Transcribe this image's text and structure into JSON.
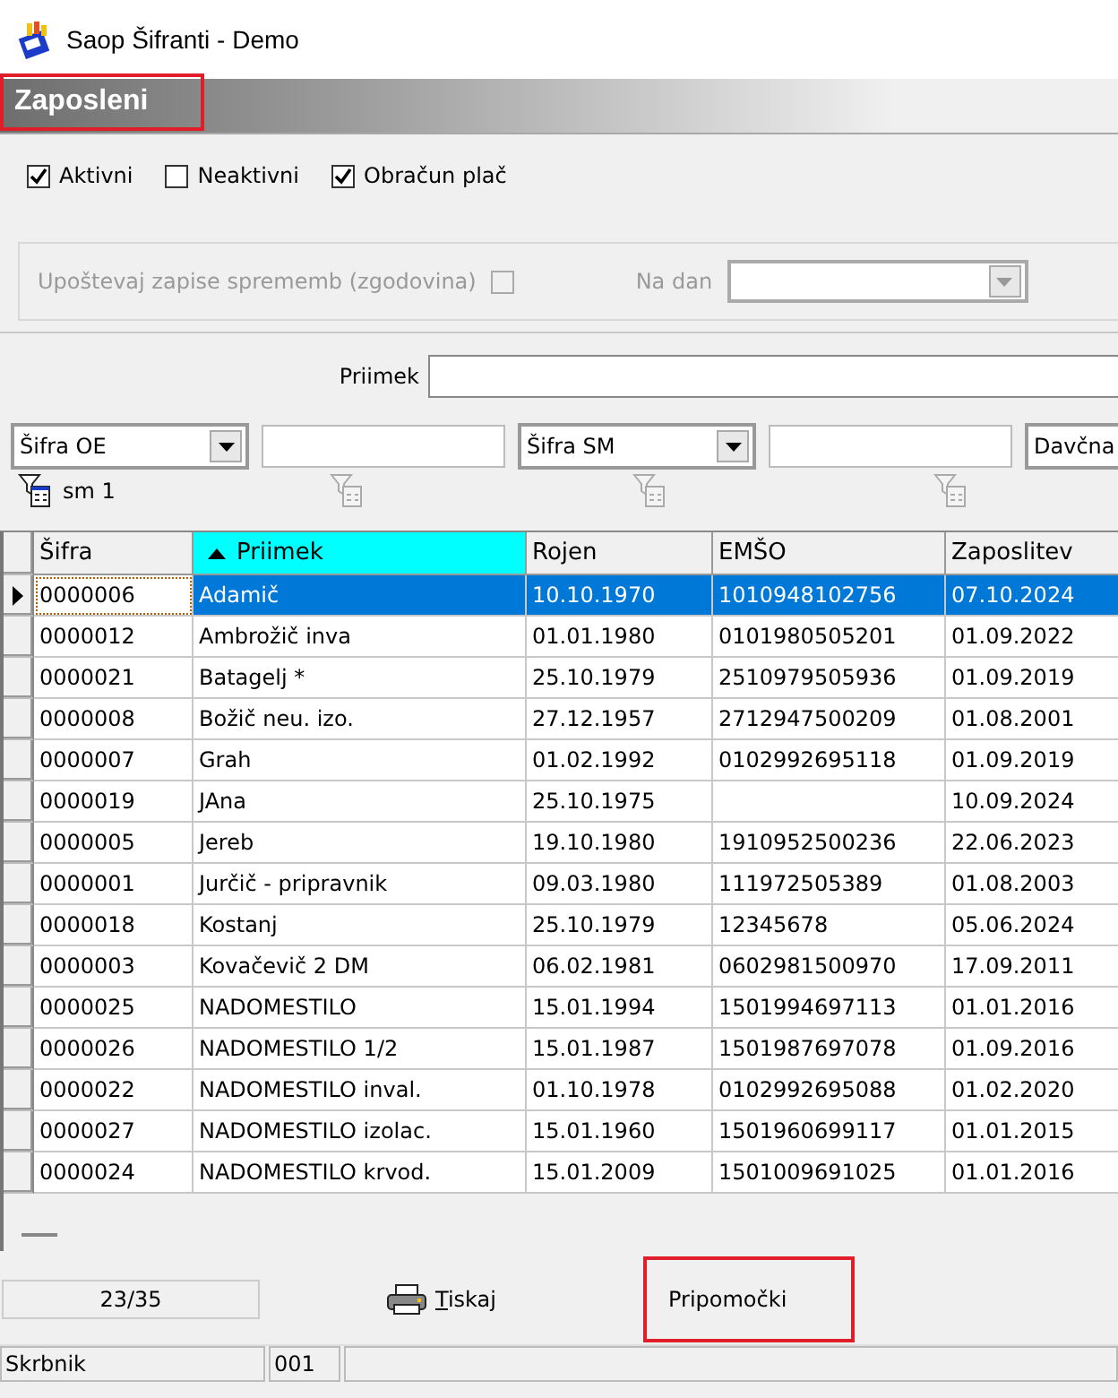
{
  "window": {
    "title": "Saop Šifranti - Demo"
  },
  "panel_title": {
    "text": "Zaposleni",
    "highlighted": true
  },
  "filters": [
    {
      "label": "Aktivni",
      "checked": true
    },
    {
      "label": "Neaktivni",
      "checked": false
    },
    {
      "label": "Obračun plač",
      "checked": true
    }
  ],
  "history_group": {
    "label": "Upoštevaj zapise sprememb (zgodovina)",
    "checked": false,
    "disabled": true,
    "date_label": "Na dan"
  },
  "search": {
    "label": "Priimek"
  },
  "field_filters": [
    {
      "selector": "Šifra OE"
    },
    {
      "selector": "Šifra SM"
    },
    {
      "selector": "Davčna"
    }
  ],
  "filter_icons": [
    {
      "active": true,
      "label": "sm 1"
    },
    {
      "active": false
    },
    {
      "active": false
    },
    {
      "active": false
    }
  ],
  "table": {
    "columns": [
      {
        "label": "Šifra",
        "sorted": false
      },
      {
        "label": "Priimek",
        "sorted": true
      },
      {
        "label": "Rojen",
        "sorted": false
      },
      {
        "label": "EMŠO",
        "sorted": false
      },
      {
        "label": "Zaposlitev",
        "sorted": false
      }
    ],
    "rows": [
      {
        "selected": true,
        "cells": [
          "0000006",
          "Adamič",
          "10.10.1970",
          "1010948102756",
          "07.10.2024"
        ]
      },
      {
        "selected": false,
        "cells": [
          "0000012",
          "Ambrožič inva",
          "01.01.1980",
          "0101980505201",
          "01.09.2022"
        ]
      },
      {
        "selected": false,
        "cells": [
          "0000021",
          "Batagelj *",
          "25.10.1979",
          "2510979505936",
          "01.09.2019"
        ]
      },
      {
        "selected": false,
        "cells": [
          "0000008",
          "Božič neu. izo.",
          "27.12.1957",
          "2712947500209",
          "01.08.2001"
        ]
      },
      {
        "selected": false,
        "cells": [
          "0000007",
          "Grah",
          "01.02.1992",
          "0102992695118",
          "01.09.2019"
        ]
      },
      {
        "selected": false,
        "cells": [
          "0000019",
          "JAna",
          "25.10.1975",
          null,
          "10.09.2024"
        ]
      },
      {
        "selected": false,
        "cells": [
          "0000005",
          "Jereb",
          "19.10.1980",
          "1910952500236",
          "22.06.2023"
        ]
      },
      {
        "selected": false,
        "cells": [
          "0000001",
          "Jurčič - pripravnik",
          "09.03.1980",
          "111972505389",
          "01.08.2003"
        ]
      },
      {
        "selected": false,
        "cells": [
          "0000018",
          "Kostanj",
          "25.10.1979",
          "12345678",
          "05.06.2024"
        ]
      },
      {
        "selected": false,
        "cells": [
          "0000003",
          "Kovačevič 2 DM",
          "06.02.1981",
          "0602981500970",
          "17.09.2011"
        ]
      },
      {
        "selected": false,
        "cells": [
          "0000025",
          "NADOMESTILO",
          "15.01.1994",
          "1501994697113",
          "01.01.2016"
        ]
      },
      {
        "selected": false,
        "cells": [
          "0000026",
          "NADOMESTILO 1/2",
          "15.01.1987",
          "1501987697078",
          "01.09.2016"
        ]
      },
      {
        "selected": false,
        "cells": [
          "0000022",
          "NADOMESTILO inval.",
          "01.10.1978",
          "0102992695088",
          "01.02.2020"
        ]
      },
      {
        "selected": false,
        "cells": [
          "0000027",
          "NADOMESTILO izolac.",
          "15.01.1960",
          "1501960699117",
          "01.01.2015"
        ]
      },
      {
        "selected": false,
        "cells": [
          "0000024",
          "NADOMESTILO krvod.",
          "15.01.2009",
          "1501009691025",
          "01.01.2016"
        ]
      }
    ]
  },
  "record_count": "23/35",
  "buttons": [
    {
      "label": "Tiskaj",
      "kind": "print",
      "highlighted": false
    },
    {
      "label": "Pripomočki",
      "kind": "plain",
      "highlighted": true
    }
  ],
  "status_bar": [
    "Skrbnik",
    "001"
  ]
}
